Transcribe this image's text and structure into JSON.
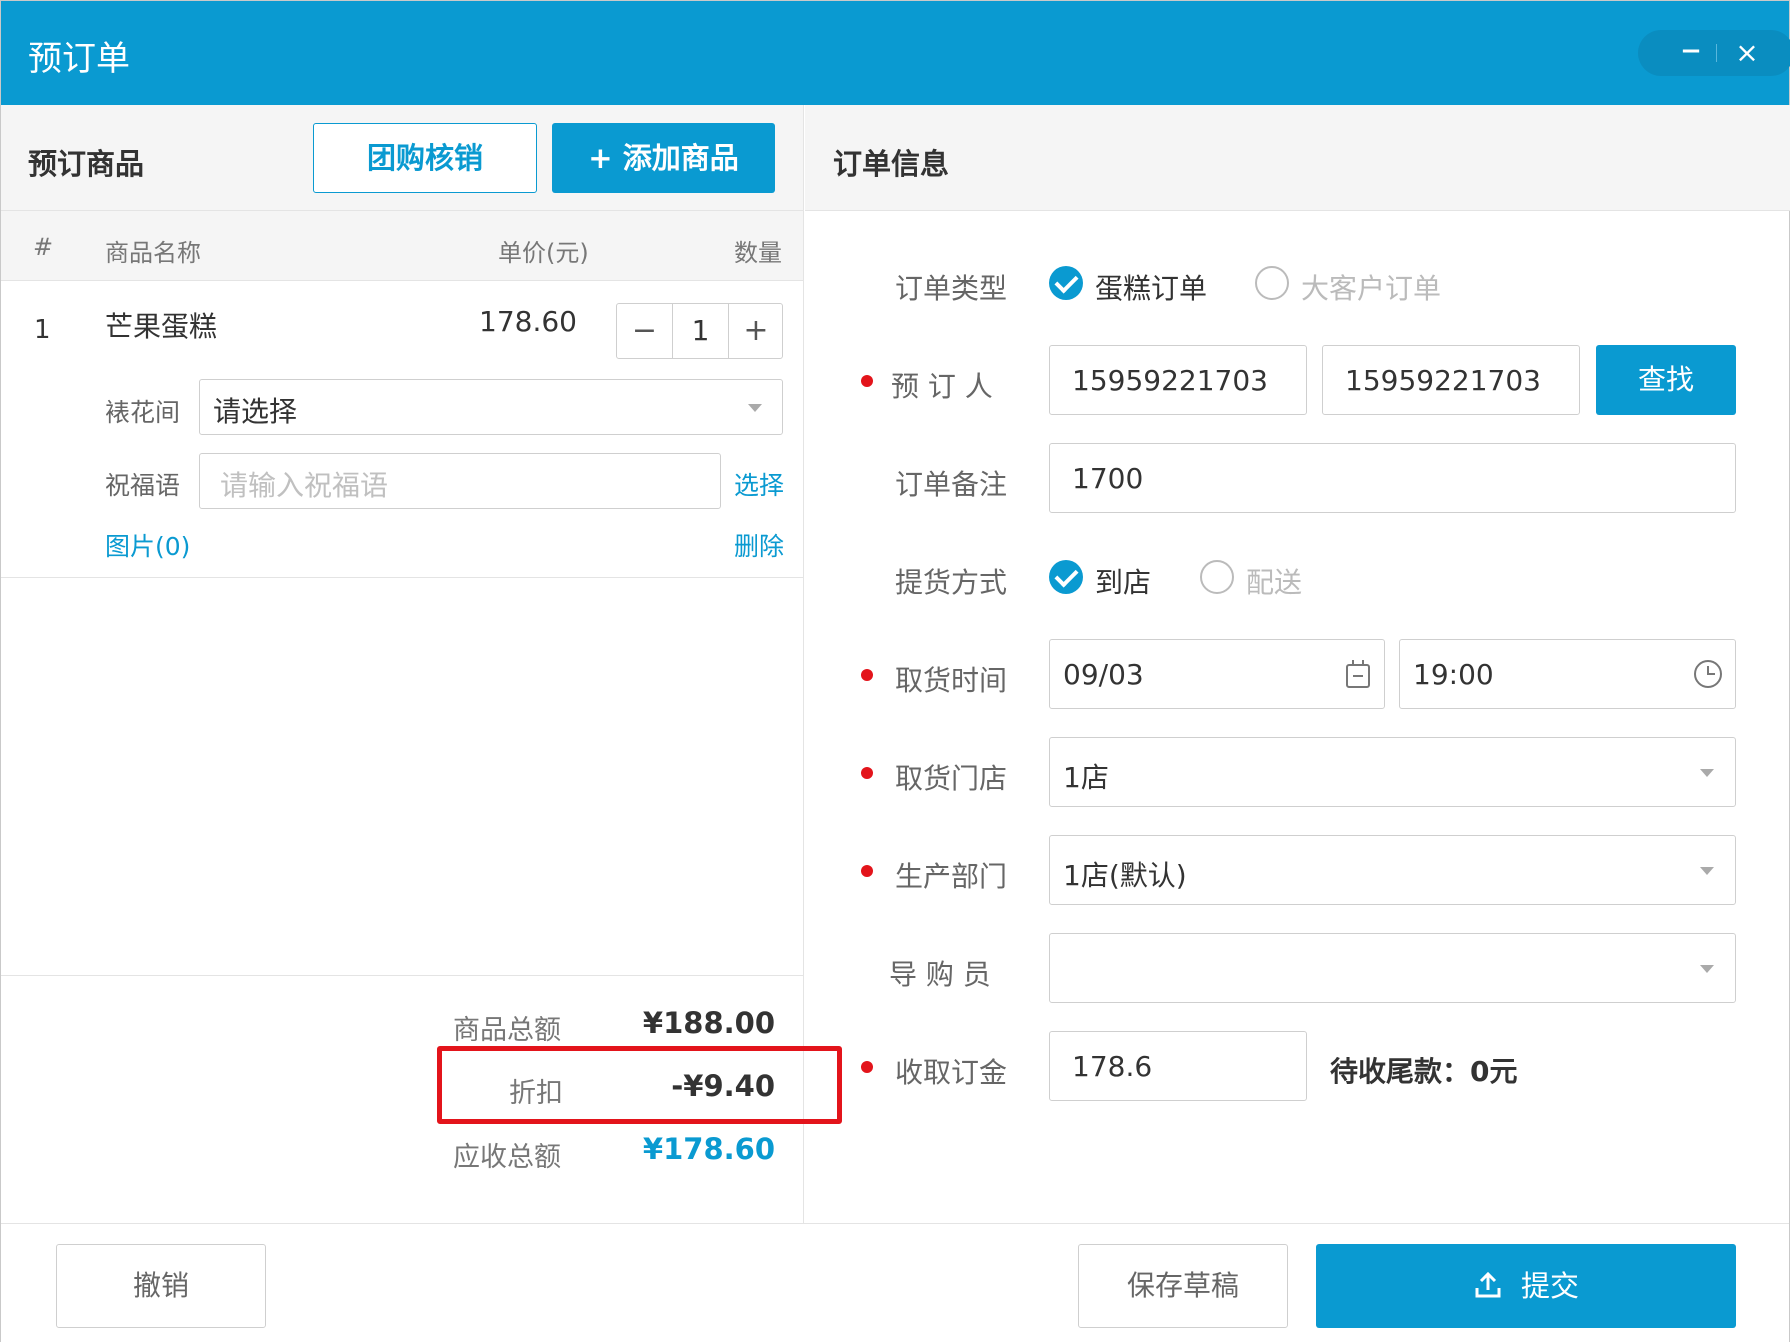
{
  "window": {
    "title": "预订单",
    "minimize_glyph": "−",
    "close_glyph": "×"
  },
  "left_panel": {
    "title": "预订商品",
    "groupbuy_button": "团购核销",
    "add_button": "+ 添加商品",
    "columns": [
      "#",
      "商品名称",
      "单价(元)",
      "数量"
    ],
    "items": [
      {
        "index": "1",
        "name": "芒果蛋糕",
        "price": "178.60",
        "qty": "1",
        "stepper_minus": "−",
        "stepper_plus": "+",
        "flower_room_label": "裱花间",
        "flower_room_value": "请选择",
        "blessing_label": "祝福语",
        "blessing_placeholder": "请输入祝福语",
        "blessing_choose": "选择",
        "images_link": "图片(0)",
        "delete_link": "删除"
      }
    ],
    "totals": {
      "goods_total_label": "商品总额",
      "goods_total_value": "¥188.00",
      "discount_label": "折扣",
      "discount_value": "-¥9.40",
      "receivable_label": "应收总额",
      "receivable_value": "¥178.60"
    }
  },
  "right_panel": {
    "title": "订单信息",
    "order_type": {
      "label": "订单类型",
      "options": [
        "蛋糕订单",
        "大客户订单"
      ],
      "selected": "蛋糕订单"
    },
    "booker": {
      "label": "预 订 人",
      "value1": "15959221703",
      "value2": "15959221703",
      "find_button": "查找"
    },
    "remark": {
      "label": "订单备注",
      "value": "1700"
    },
    "pickup_method": {
      "label": "提货方式",
      "options": [
        "到店",
        "配送"
      ],
      "selected": "到店"
    },
    "pickup_time": {
      "label": "取货时间",
      "date": "09/03",
      "time": "19:00"
    },
    "pickup_store": {
      "label": "取货门店",
      "value": "1店"
    },
    "production_dept": {
      "label": "生产部门",
      "value": "1店(默认)"
    },
    "guide": {
      "label": "导 购 员",
      "value": ""
    },
    "deposit": {
      "label": "收取订金",
      "value": "178.6",
      "owed_text": "待收尾款：0元"
    }
  },
  "footer": {
    "cancel_button": "撤销",
    "save_draft_button": "保存草稿",
    "submit_button": "提交"
  },
  "colors": {
    "primary": "#0a9ad1",
    "highlight": "#e3141b",
    "required_dot": "#e3141b"
  }
}
